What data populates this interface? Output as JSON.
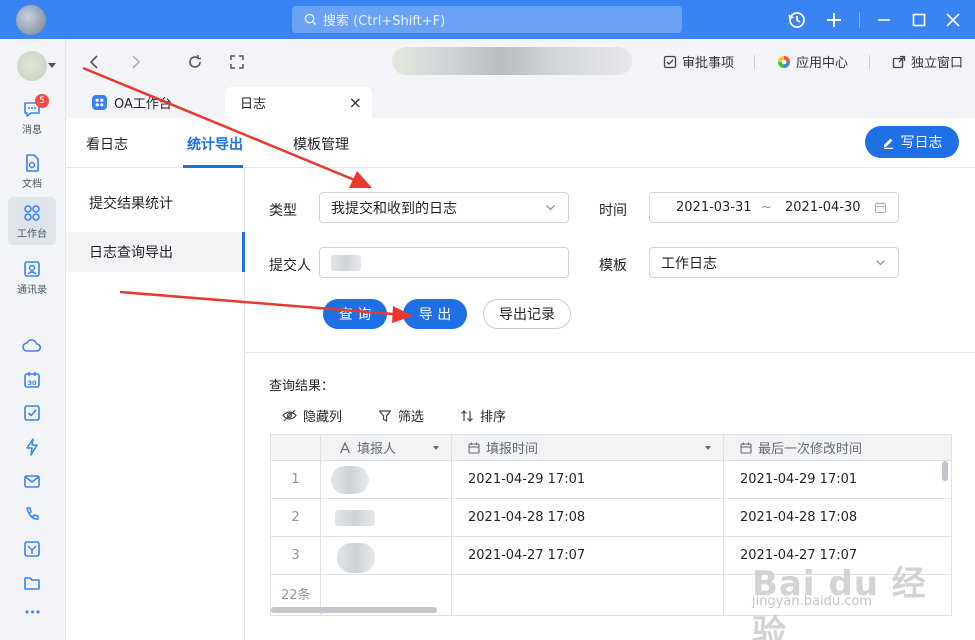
{
  "titlebar": {
    "search_placeholder": "搜索 (Ctrl+Shift+F)"
  },
  "leftnav": {
    "items": [
      {
        "label": "消息",
        "badge": "5",
        "icon": "message-icon"
      },
      {
        "label": "文档",
        "icon": "document-icon"
      },
      {
        "label": "工作台",
        "icon": "workbench-icon",
        "active": true
      },
      {
        "label": "通讯录",
        "icon": "contacts-icon"
      }
    ],
    "small_icons": [
      "cloud-icon",
      "calendar-icon",
      "checkbox-icon",
      "lightning-icon",
      "mail-icon",
      "phone-icon",
      "approval-icon",
      "folder-icon",
      "more-icon"
    ],
    "calendar_day": "30",
    "more_glyph": "•••"
  },
  "toolbar": {
    "links": [
      {
        "label": "审批事项",
        "icon": "approval-check-icon"
      },
      {
        "label": "应用中心",
        "icon": "app-center-icon"
      },
      {
        "label": "独立窗口",
        "icon": "separate-window-icon"
      }
    ]
  },
  "tabs": [
    {
      "label": "OA工作台",
      "icon": "oa-app-icon"
    },
    {
      "label": "日志",
      "active": true,
      "close": "×"
    }
  ],
  "subtabs": [
    {
      "label": "看日志"
    },
    {
      "label": "统计导出",
      "active": true
    },
    {
      "label": "模板管理"
    }
  ],
  "write_button": "写日志",
  "sidemenu": [
    {
      "label": "提交结果统计"
    },
    {
      "label": "日志查询导出",
      "active": true
    }
  ],
  "form": {
    "type_label": "类型",
    "type_value": "我提交和收到的日志",
    "time_label": "时间",
    "date_start": "2021-03-31",
    "date_sep": "~",
    "date_end": "2021-04-30",
    "submitter_label": "提交人",
    "template_label": "模板",
    "template_value": "工作日志"
  },
  "buttons": {
    "query": "查 询",
    "export": "导 出",
    "export_history": "导出记录"
  },
  "results": {
    "label": "查询结果：",
    "tools": [
      {
        "label": "隐藏列",
        "icon": "eye-icon"
      },
      {
        "label": "筛选",
        "icon": "filter-icon"
      },
      {
        "label": "排序",
        "icon": "sort-icon"
      }
    ],
    "columns": [
      {
        "label": "填报人",
        "icon": "text-field-icon"
      },
      {
        "label": "填报时间",
        "icon": "date-field-icon"
      },
      {
        "label": "最后一次修改时间",
        "icon": "date-field-icon"
      }
    ],
    "rows": [
      {
        "num": "1",
        "fill_time": "2021-04-29 17:01",
        "modified_time": "2021-04-29 17:01"
      },
      {
        "num": "2",
        "fill_time": "2021-04-28 17:08",
        "modified_time": "2021-04-28 17:08"
      },
      {
        "num": "3",
        "fill_time": "2021-04-27 17:07",
        "modified_time": "2021-04-27 17:07"
      }
    ],
    "count": "22条"
  },
  "watermark": {
    "logo": "Bai du 经验",
    "url": "jingyan.baidu.com"
  },
  "colors": {
    "brand": "#3a84f2",
    "primary": "#1f6fe5",
    "annotation": "#e8392f"
  }
}
